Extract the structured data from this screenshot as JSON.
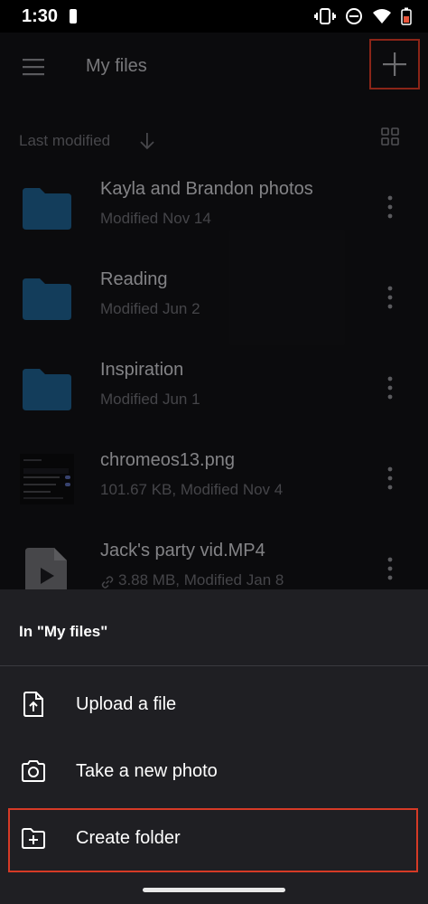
{
  "status_bar": {
    "time": "1:30",
    "icons": [
      "notification-icon",
      "vibrate-icon",
      "dnd-icon",
      "wifi-icon",
      "battery-icon"
    ]
  },
  "header": {
    "title": "My files",
    "menu_icon": "menu-icon",
    "add_icon": "plus-icon"
  },
  "sort": {
    "label": "Last modified",
    "direction_icon": "arrow-down-icon",
    "view_icon": "grid-view-icon"
  },
  "files": [
    {
      "name": "Kayla and Brandon photos",
      "meta": "Modified Nov 14",
      "type": "folder"
    },
    {
      "name": "Reading",
      "meta": "Modified Jun 2",
      "type": "folder"
    },
    {
      "name": "Inspiration",
      "meta": "Modified Jun 1",
      "type": "folder"
    },
    {
      "name": "chromeos13.png",
      "meta": "101.67 KB, Modified Nov 4",
      "type": "image"
    },
    {
      "name": "Jack's party vid.MP4",
      "meta": "3.88 MB, Modified Jan 8",
      "type": "video",
      "shared": true
    }
  ],
  "sheet": {
    "header": "In \"My files\"",
    "items": [
      {
        "label": "Upload a file",
        "icon": "upload-file-icon"
      },
      {
        "label": "Take a new photo",
        "icon": "camera-icon"
      },
      {
        "label": "Create folder",
        "icon": "create-folder-icon"
      }
    ]
  },
  "colors": {
    "folder": "#1e5f8c",
    "highlight": "#d63a26",
    "sheet_bg": "#1f1f23",
    "app_bg": "#121215"
  }
}
